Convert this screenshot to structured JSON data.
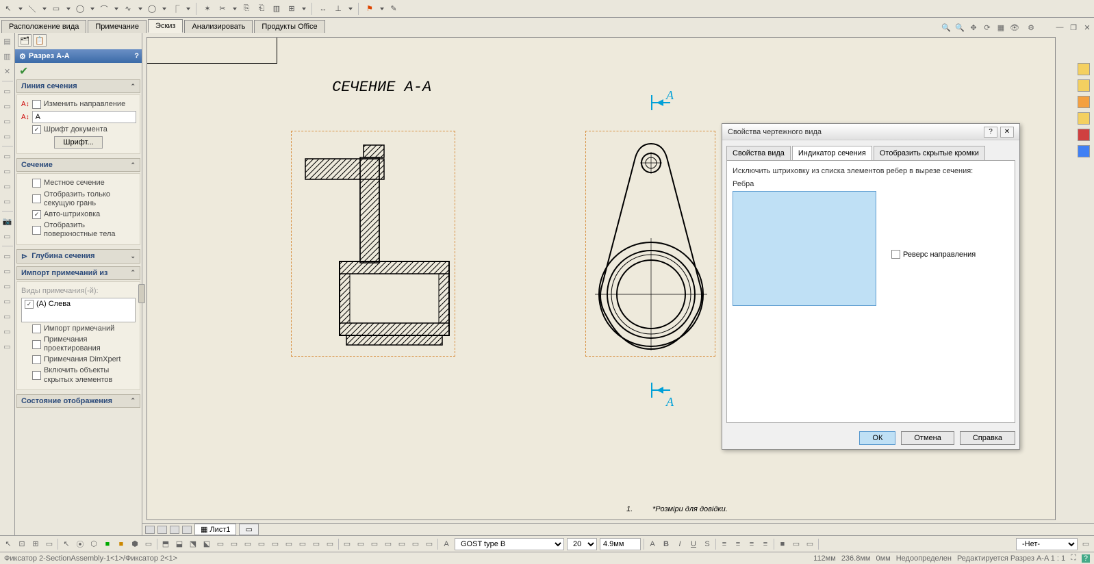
{
  "tabs": {
    "t1": "Расположение вида",
    "t2": "Примечание",
    "t3": "Эскиз",
    "t4": "Анализировать",
    "t5": "Продукты Office"
  },
  "panel": {
    "title": "Разрез A-A",
    "group1": "Линия сечения",
    "change_dir": "Изменить направление",
    "label_a": "A",
    "doc_font": "Шрифт документа",
    "font_btn": "Шрифт...",
    "group2": "Сечение",
    "local_section": "Местное сечение",
    "display_only": "Отобразить только секущую грань",
    "auto_hatch": "Авто-штриховка",
    "surface_bodies": "Отобразить поверхностные тела",
    "depth_btn": "Глубина сечения",
    "group3": "Импорт примечаний из",
    "views_lbl": "Виды примечания(-й):",
    "view_a": "(A) Слева",
    "import_notes": "Импорт примечаний",
    "design_notes": "Примечания проектирования",
    "dimxpert": "Примечания DimXpert",
    "include_hidden": "Включить объекты скрытых элементов",
    "group4": "Состояние отображения"
  },
  "canvas": {
    "section_title": "СЕЧЕНИЕ A-A",
    "arrow_label": "А",
    "ref_num": "1.",
    "ref_txt": "*Розміри для довідки."
  },
  "sheet": {
    "name": "Лист1"
  },
  "dialog": {
    "title": "Свойства чертежного вида",
    "tab1": "Свойства вида",
    "tab2": "Индикатор сечения",
    "tab3": "Отобразить скрытые кромки",
    "label1": "Исключить штриховку из списка элементов ребер в вырезе сечения:",
    "sub": "Ребра",
    "reverse": "Реверс направления",
    "ok": "ОК",
    "cancel": "Отмена",
    "help": "Справка"
  },
  "bottom": {
    "font_name": "GOST type B",
    "font_size": "20",
    "dim_val": "4.9мм"
  },
  "status": {
    "doc": "Фиксатор 2-SectionAssembly-1<1>/Фиксатор 2<1>",
    "s1": "112мм",
    "s2": "236.8мм",
    "s3": "0мм",
    "s4": "Недоопределен",
    "s5": "Редактируется Разрез A-A   1 : 1",
    "net": "-Нет-"
  }
}
